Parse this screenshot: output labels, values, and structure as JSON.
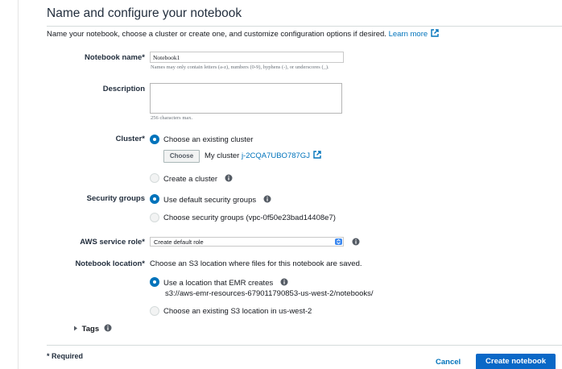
{
  "header": {
    "title": "Name and configure your notebook",
    "intro": "Name your notebook, choose a cluster or create one, and customize configuration options if desired.",
    "learn_more": "Learn more"
  },
  "notebook_name": {
    "label": "Notebook name*",
    "value": "Notebook1",
    "hint": "Names may only contain letters (a-z), numbers (0-9), hyphens (-), or underscores (_)."
  },
  "description": {
    "label": "Description",
    "value": "",
    "hint": "256 characters max."
  },
  "cluster": {
    "label": "Cluster*",
    "option_existing": "Choose an existing cluster",
    "choose_button": "Choose",
    "my_cluster_label": "My cluster",
    "cluster_id": "j-2CQA7UBO787GJ",
    "option_create": "Create a cluster",
    "selected": "existing"
  },
  "security_groups": {
    "label": "Security groups",
    "option_default": "Use default security groups",
    "option_choose": "Choose security groups (vpc-0f50e23bad14408e7)",
    "selected": "default"
  },
  "service_role": {
    "label": "AWS service role*",
    "value": "Create default role"
  },
  "notebook_location": {
    "label": "Notebook location*",
    "description": "Choose an S3 location where files for this notebook are saved.",
    "option_emr": "Use a location that EMR creates",
    "emr_path": "s3://aws-emr-resources-679011790853-us-west-2/notebooks/",
    "option_existing": "Choose an existing S3 location in us-west-2",
    "selected": "emr"
  },
  "tags": {
    "label": "Tags"
  },
  "footer": {
    "required": "* Required",
    "cancel": "Cancel",
    "create": "Create notebook"
  },
  "icons": [
    "external-link-icon",
    "info-icon",
    "caret-right-icon",
    "select-arrows-icon",
    "resize-grip-icon"
  ],
  "colors": {
    "accent": "#0073bb",
    "primary_button": "#0a68c7"
  }
}
